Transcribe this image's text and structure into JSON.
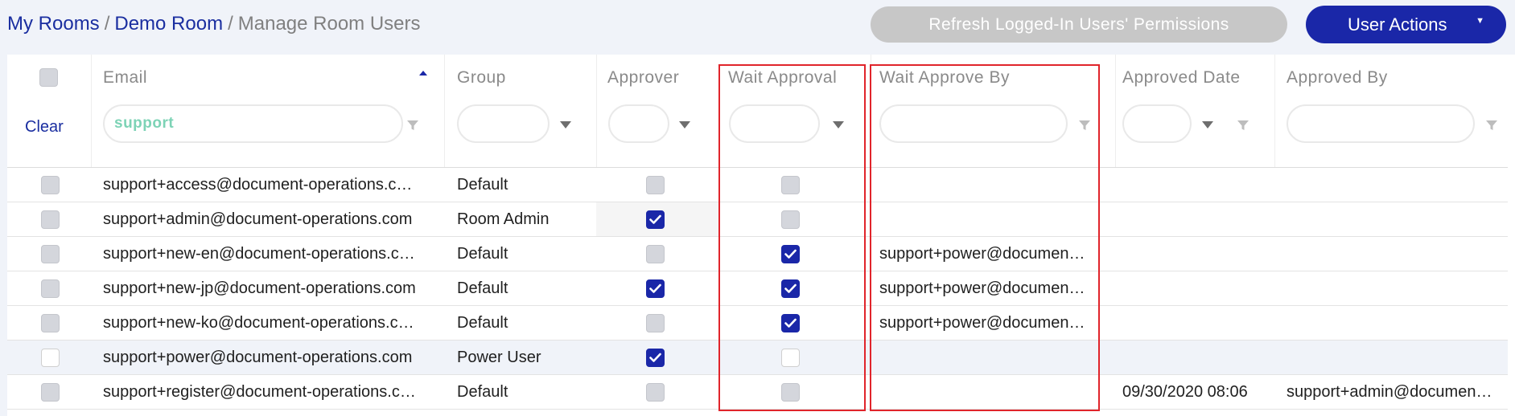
{
  "breadcrumb": {
    "link1": "My Rooms",
    "sep1": "/",
    "link2": "Demo Room",
    "sep2": "/",
    "current": "Manage Room Users"
  },
  "toolbar": {
    "refresh_label": "Refresh Logged-In Users' Permissions",
    "actions_label": "User Actions",
    "actions_caret": "▼"
  },
  "columns": {
    "email": "Email",
    "group": "Group",
    "approver": "Approver",
    "wait_approval": "Wait Approval",
    "wait_approve_by": "Wait Approve By",
    "approved_date": "Approved Date",
    "approved_by": "Approved By"
  },
  "filters": {
    "clear_label": "Clear",
    "email_value": "support"
  },
  "rows": [
    {
      "email": "support+access@document-operations.c…",
      "group": "Default",
      "approver": false,
      "wait_approval": false,
      "wait_approve_by": "",
      "approved_date": "",
      "approved_by": "",
      "selected_style": "off"
    },
    {
      "email": "support+admin@document-operations.com",
      "group": "Room Admin",
      "approver": true,
      "wait_approval": false,
      "wait_approve_by": "",
      "approved_date": "",
      "approved_by": "",
      "selected_style": "off"
    },
    {
      "email": "support+new-en@document-operations.c…",
      "group": "Default",
      "approver": false,
      "wait_approval": true,
      "wait_approve_by": "support+power@documen…",
      "approved_date": "",
      "approved_by": "",
      "selected_style": "off"
    },
    {
      "email": "support+new-jp@document-operations.com",
      "group": "Default",
      "approver": true,
      "wait_approval": true,
      "wait_approve_by": "support+power@documen…",
      "approved_date": "",
      "approved_by": "",
      "selected_style": "off"
    },
    {
      "email": "support+new-ko@document-operations.c…",
      "group": "Default",
      "approver": false,
      "wait_approval": true,
      "wait_approve_by": "support+power@documen…",
      "approved_date": "",
      "approved_by": "",
      "selected_style": "off"
    },
    {
      "email": "support+power@document-operations.com",
      "group": "Power User",
      "approver": true,
      "wait_approval": false,
      "wait_approve_by": "",
      "approved_date": "",
      "approved_by": "",
      "selected_style": "white"
    },
    {
      "email": "support+register@document-operations.c…",
      "group": "Default",
      "approver": false,
      "wait_approval": false,
      "wait_approve_by": "",
      "approved_date": "09/30/2020 08:06",
      "approved_by": "support+admin@documen…",
      "selected_style": "off"
    }
  ],
  "colors": {
    "accent": "#1a27a8",
    "highlight_border": "#e0242b",
    "filter_text": "#7dd3b6"
  }
}
